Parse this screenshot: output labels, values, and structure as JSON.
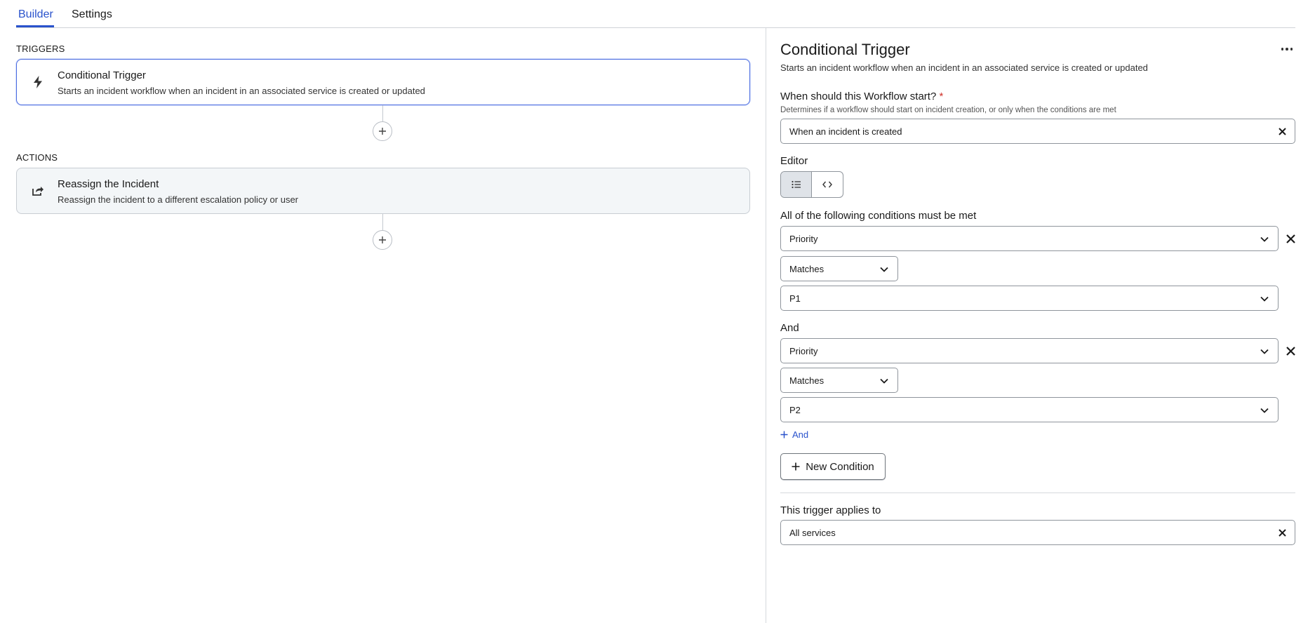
{
  "tabs": [
    {
      "label": "Builder",
      "active": true
    },
    {
      "label": "Settings",
      "active": false
    }
  ],
  "left": {
    "triggers_label": "TRIGGERS",
    "trigger": {
      "title": "Conditional Trigger",
      "description": "Starts an incident workflow when an incident in an associated service is created or updated",
      "icon": "lightning-icon"
    },
    "actions_label": "ACTIONS",
    "action": {
      "title": "Reassign the Incident",
      "description": "Reassign the incident to a different escalation policy or user",
      "icon": "share-arrow-icon"
    }
  },
  "panel": {
    "title": "Conditional Trigger",
    "subtitle": "Starts an incident workflow when an incident in an associated service is created or updated",
    "start": {
      "label": "When should this Workflow start?",
      "required_mark": "*",
      "help": "Determines if a workflow should start on incident creation, or only when the conditions are met",
      "value": "When an incident is created"
    },
    "editor_label": "Editor",
    "conditions_label": "All of the following conditions must be met",
    "condition1": {
      "field": "Priority",
      "operator": "Matches",
      "value": "P1"
    },
    "and_label": "And",
    "condition2": {
      "field": "Priority",
      "operator": "Matches",
      "value": "P2"
    },
    "add_and_label": "And",
    "new_condition_label": "New Condition",
    "applies_label": "This trigger applies to",
    "applies_value": "All services"
  },
  "colors": {
    "accent": "#2952cc",
    "required": "#d0332b"
  }
}
